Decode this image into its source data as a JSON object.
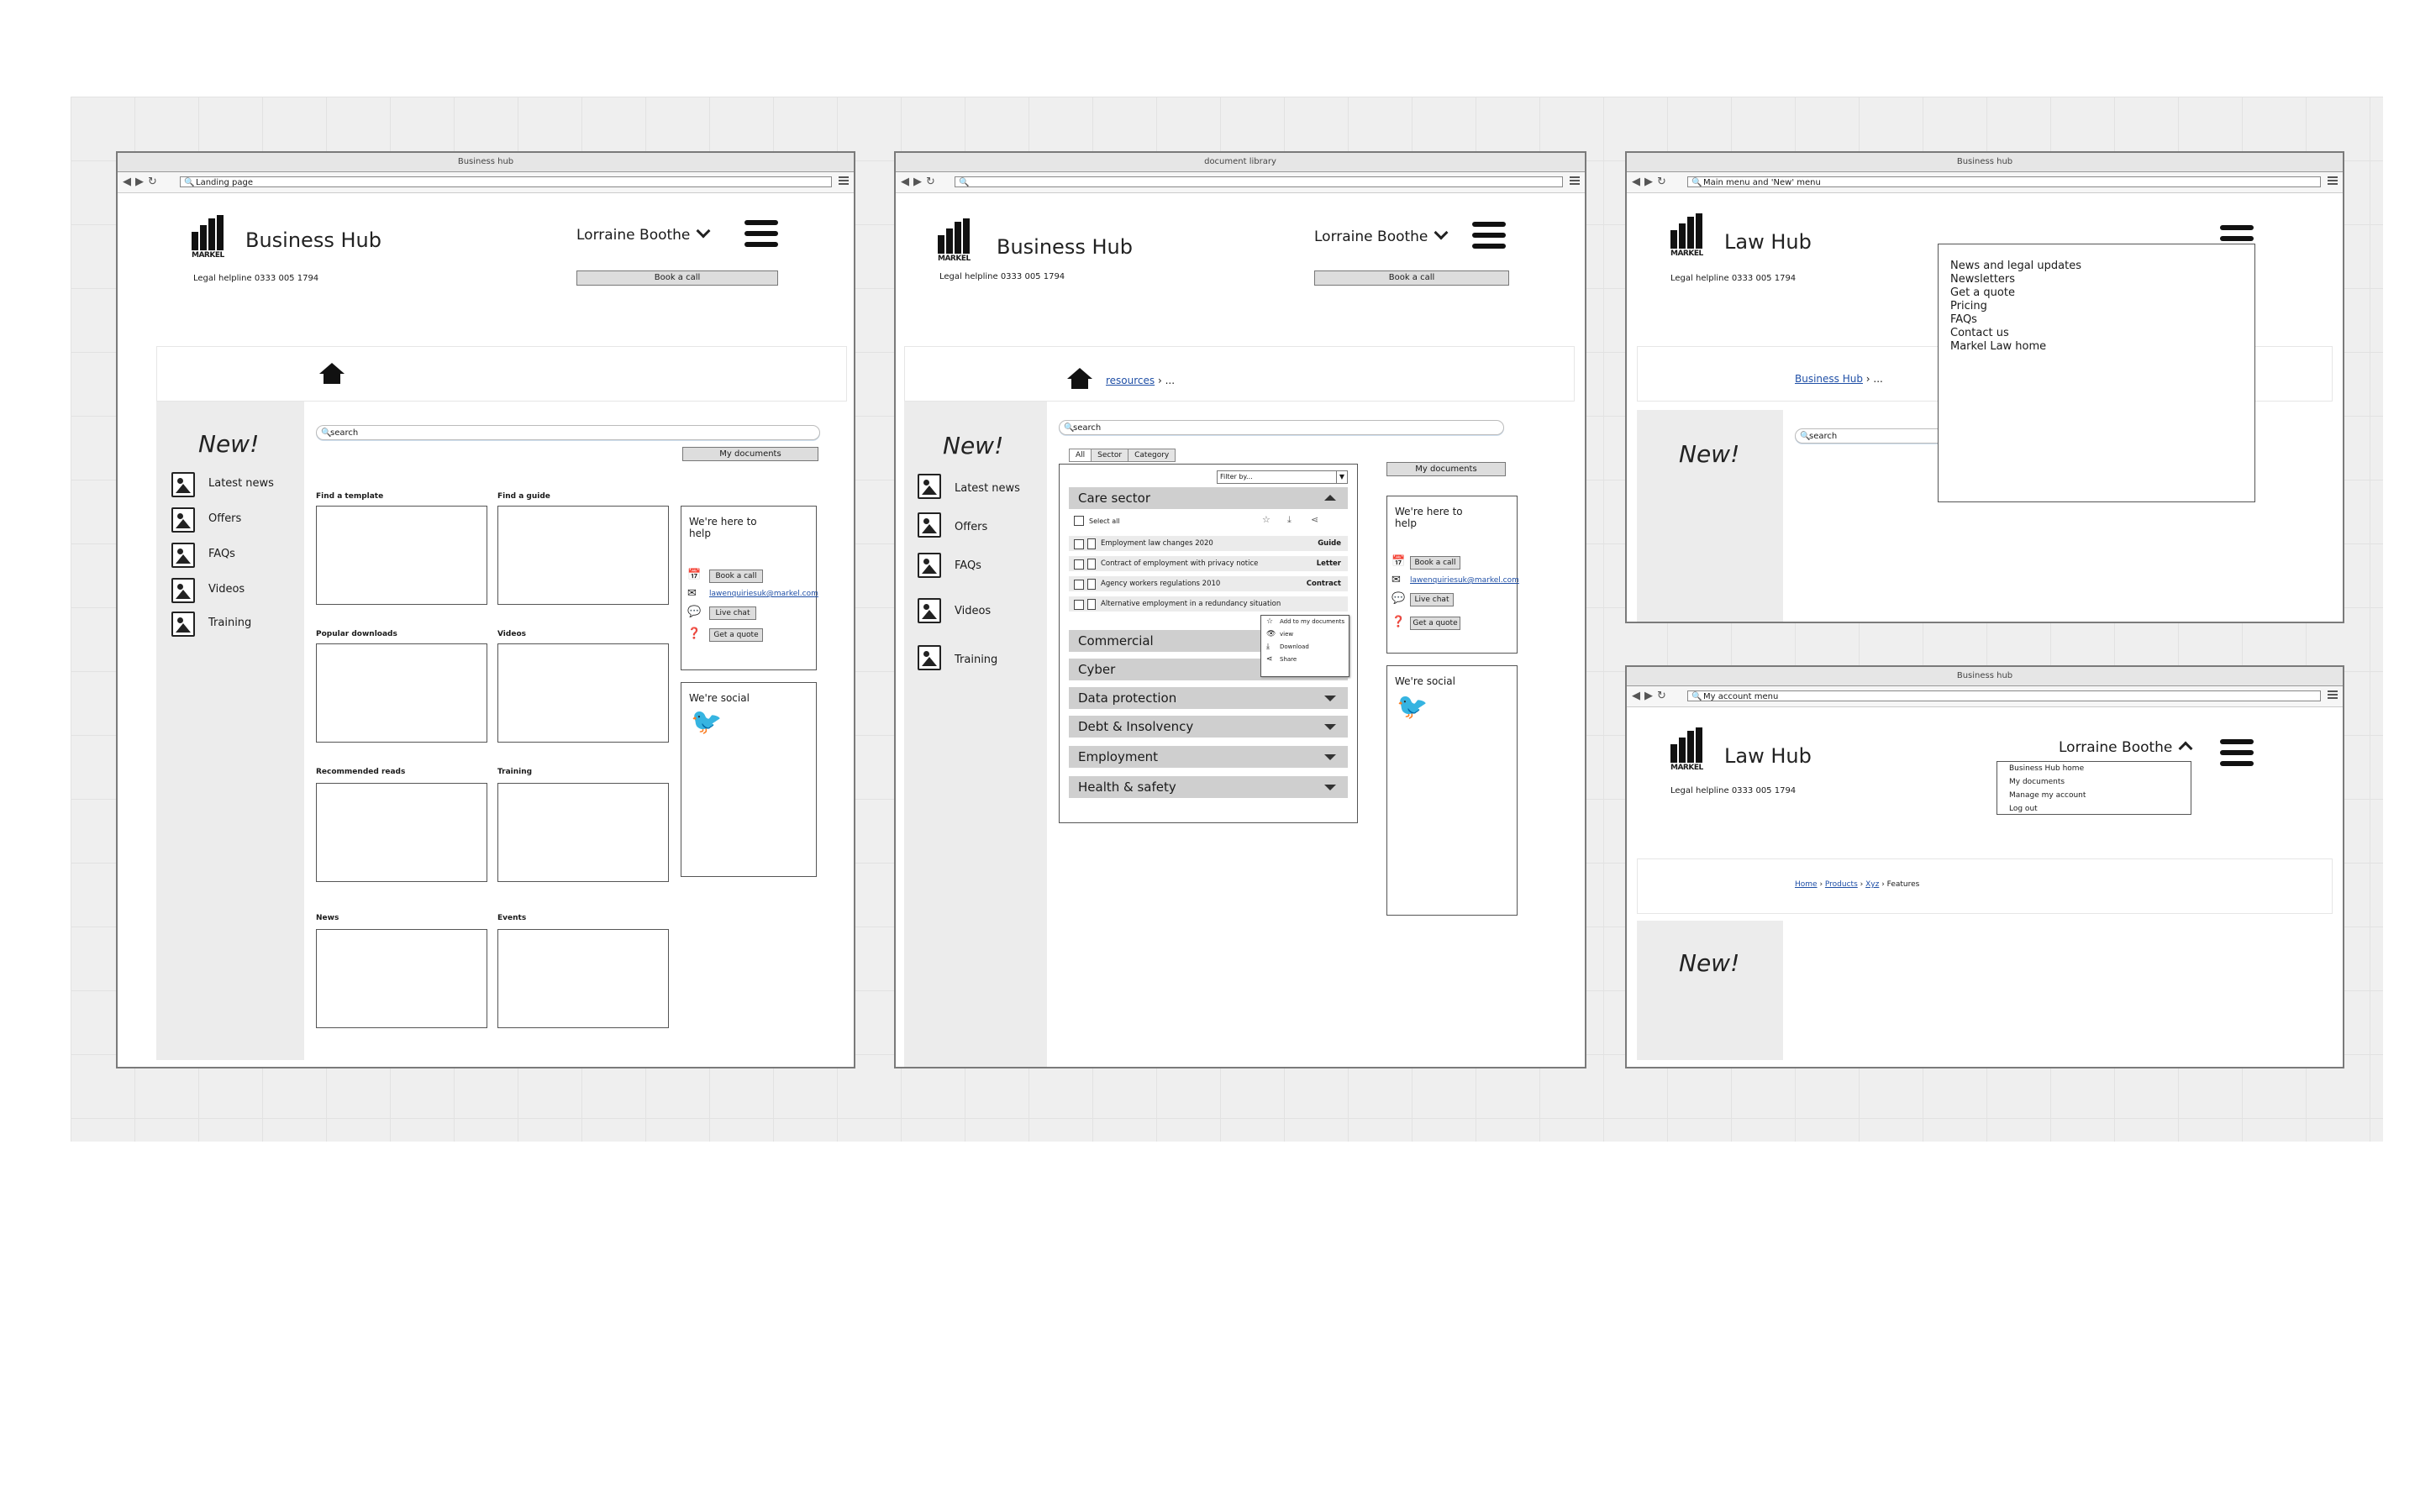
{
  "logo_text": "MARKEL",
  "win1": {
    "title": "Business hub",
    "address": "Landing page",
    "hub_title": "Business Hub",
    "helpline": "Legal helpline 0333 005 1794",
    "user": "Lorraine Boothe",
    "book_call": "Book a call",
    "new_label": "New!",
    "sidebar": [
      "Latest news",
      "Offers",
      "FAQs",
      "Videos",
      "Training"
    ],
    "search_placeholder": "search",
    "my_documents": "My documents",
    "sections": [
      "Find a template",
      "Find a guide",
      "Popular downloads",
      "Videos",
      "Recommended reads",
      "Training",
      "News",
      "Events"
    ],
    "help_title": "We're here to help",
    "help_book": "Book a call",
    "help_email": "lawenquiriesuk@markel.com",
    "help_chat": "Live chat",
    "help_quote": "Get a quote",
    "social_title": "We're social"
  },
  "win2": {
    "title": "document library",
    "address": "",
    "hub_title": "Business Hub",
    "helpline": "Legal helpline 0333 005 1794",
    "user": "Lorraine Boothe",
    "book_call": "Book a call",
    "breadcrumb_link": "resources",
    "breadcrumb_rest": " › ...",
    "new_label": "New!",
    "sidebar": [
      "Latest news",
      "Offers",
      "FAQs",
      "Videos",
      "Training"
    ],
    "search_placeholder": "search",
    "tabs": [
      "All",
      "Sector",
      "Category"
    ],
    "filter": "Filter by...",
    "my_documents": "My documents",
    "care_sector": "Care sector",
    "select_all": "Select all",
    "rows": [
      {
        "name": "Employment law changes 2020",
        "type": "Guide"
      },
      {
        "name": "Contract of employment with privacy notice",
        "type": "Letter"
      },
      {
        "name": "Agency workers regulations 2010",
        "type": "Contract"
      },
      {
        "name": "Alternative employment in a redundancy situation",
        "type": ""
      }
    ],
    "context_menu": [
      "Add to my documents",
      "view",
      "Download",
      "Share"
    ],
    "categories": [
      "Commercial",
      "Cyber",
      "Data protection",
      "Debt & Insolvency",
      "Employment",
      "Health & safety"
    ],
    "help_title": "We're here to help",
    "help_book": "Book a call",
    "help_email": "lawenquiriesuk@markel.com",
    "help_chat": "Live chat",
    "help_quote": "Get a quote",
    "social_title": "We're social"
  },
  "win3": {
    "title": "Business hub",
    "address": "Main menu and 'New' menu",
    "hub_title": "Law Hub",
    "helpline": "Legal helpline 0333 005 1794",
    "breadcrumb_link": "Business Hub",
    "breadcrumb_rest": " › ...",
    "new_label": "New!",
    "search_placeholder": "search",
    "menu": [
      "News and legal updates",
      "Newsletters",
      "Get a quote",
      "Pricing",
      "FAQs",
      "Contact us",
      "Markel Law home"
    ]
  },
  "win4": {
    "title": "Business hub",
    "address": "My account menu",
    "hub_title": "Law Hub",
    "helpline": "Legal helpline 0333 005 1794",
    "user": "Lorraine Boothe",
    "user_menu": [
      "Business Hub home",
      "My documents",
      "Manage my account",
      "Log out"
    ],
    "breadcrumb": [
      "Home",
      "Products",
      "Xyz"
    ],
    "breadcrumb_current": "Features",
    "new_label": "New!"
  }
}
